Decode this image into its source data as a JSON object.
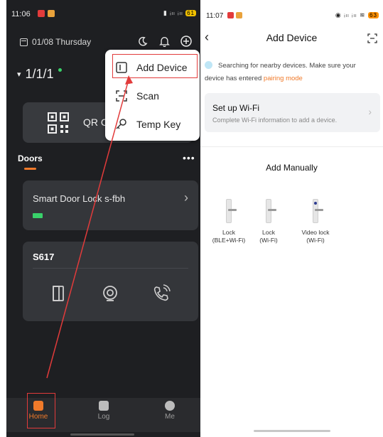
{
  "left": {
    "status": {
      "time": "11:06",
      "right": "▮ ᵢₗₗ ᵢₗₗ",
      "battery": "61"
    },
    "date": "01/08 Thursday",
    "home_label": "1/1/1",
    "qr_label": "QR C",
    "tabs": {
      "doors": "Doors"
    },
    "lock_card": {
      "name": "Smart Door Lock s-fbh"
    },
    "s617": {
      "title": "S617"
    },
    "menu": {
      "add_device": "Add Device",
      "scan": "Scan",
      "temp_key": "Temp Key"
    },
    "nav": {
      "home": "Home",
      "log": "Log",
      "me": "Me"
    },
    "colors": {
      "accent": "#f07a2a",
      "highlight": "#e23b3b",
      "online": "#39d16a"
    }
  },
  "right": {
    "status": {
      "time": "11:07",
      "right": "◉ ᵢₗₗ ᵢₗₗ ≋",
      "battery": "63"
    },
    "title": "Add Device",
    "search_text": "Searching for nearby devices. Make sure your device has entered ",
    "pairing_mode": "pairing mode",
    "wifi": {
      "title": "Set up Wi-Fi",
      "subtitle": "Complete Wi-Fi information to add a device."
    },
    "manual_title": "Add Manually",
    "devices": [
      {
        "line1": "Lock",
        "line2": "(BLE+Wi-Fi)"
      },
      {
        "line1": "Lock",
        "line2": "(Wi-Fi)"
      },
      {
        "line1": "Video lock",
        "line2": "(Wi-Fi)"
      }
    ]
  }
}
